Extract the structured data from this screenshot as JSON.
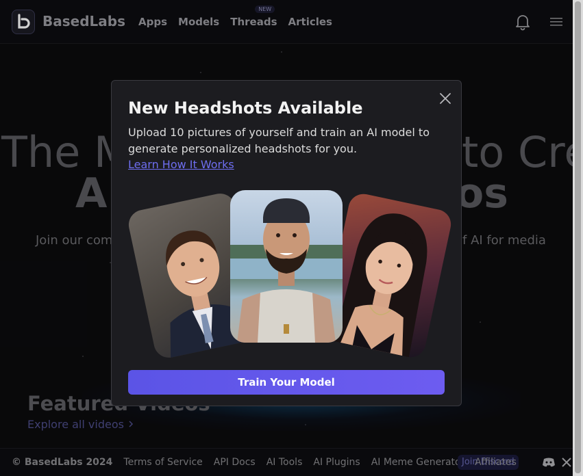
{
  "header": {
    "brand": "BasedLabs",
    "nav": [
      "Apps",
      "Models",
      "Threads",
      "Articles"
    ],
    "new_badge": "NEW"
  },
  "hero": {
    "line1_left": "The M",
    "line1_right": "to Cre",
    "line2_left": "A",
    "line2_right": "os",
    "sub_left": "Join our com",
    "sub_right": "of AI for media"
  },
  "featured": {
    "title": "Featured Videos",
    "explore": "Explore all videos"
  },
  "footer": {
    "copyright": "© BasedLabs 2024",
    "links": [
      "Terms of Service",
      "API Docs",
      "AI Tools",
      "AI Plugins",
      "AI Meme Generator",
      "Affiliates"
    ],
    "join_pill": "Join Discord"
  },
  "modal": {
    "title": "New Headshots Available",
    "description": "Upload 10 pictures of yourself and train an AI model to generate personalized headshots for you.",
    "link": "Learn How It Works",
    "button": "Train Your Model"
  },
  "colors": {
    "accent": "#5b54e6",
    "link": "#6e6ef0",
    "modal_bg": "#1c1c20",
    "page_bg": "#0b0b0d"
  },
  "icons": [
    "logo-icon",
    "bell-icon",
    "menu-icon",
    "close-icon",
    "chevron-right-icon",
    "discord-icon",
    "x-icon"
  ]
}
